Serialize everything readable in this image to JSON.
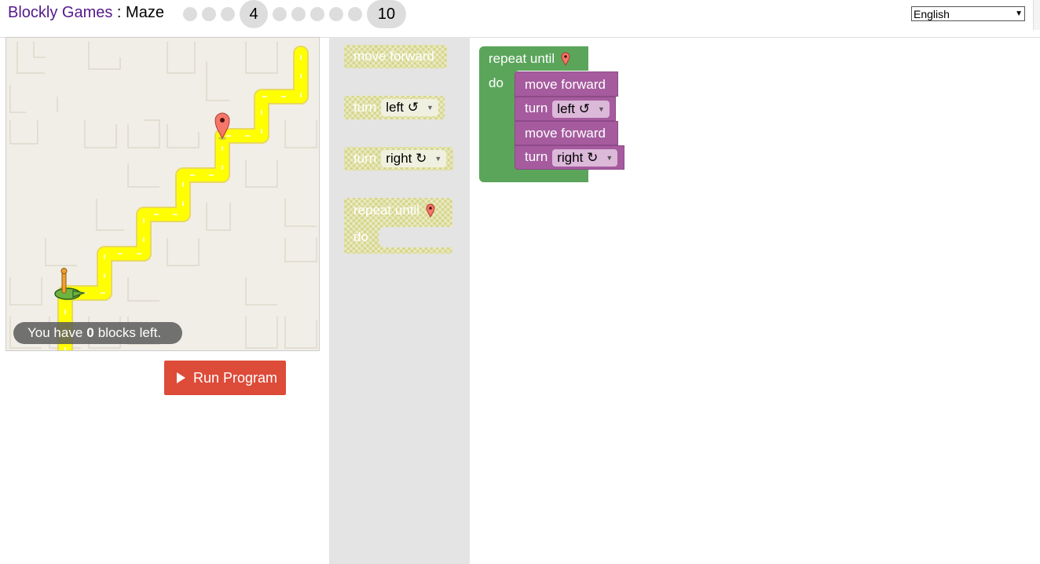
{
  "header": {
    "brand": "Blockly Games",
    "separator": " : ",
    "game": "Maze",
    "levels": [
      {
        "n": "1",
        "current": false,
        "shown": false
      },
      {
        "n": "2",
        "current": false,
        "shown": false
      },
      {
        "n": "3",
        "current": false,
        "shown": false
      },
      {
        "n": "4",
        "current": true,
        "shown": true
      },
      {
        "n": "5",
        "current": false,
        "shown": false
      },
      {
        "n": "6",
        "current": false,
        "shown": false
      },
      {
        "n": "7",
        "current": false,
        "shown": false
      },
      {
        "n": "8",
        "current": false,
        "shown": false
      },
      {
        "n": "9",
        "current": false,
        "shown": false
      },
      {
        "n": "10",
        "current": false,
        "shown": true
      }
    ],
    "current_level": "4",
    "last_level": "10",
    "language": "English"
  },
  "maze": {
    "capacity_prefix": "You have",
    "capacity_count": "0",
    "capacity_suffix": "blocks left."
  },
  "run_button": "Run Program",
  "toolbox": {
    "move_forward": "move forward",
    "turn_left_label": "turn",
    "turn_left_field": "left ↺",
    "turn_right_label": "turn",
    "turn_right_field": "right ↻",
    "repeat_until": "repeat until",
    "do": "do"
  },
  "workspace": {
    "repeat_until": "repeat until",
    "do": "do",
    "move_forward_1": "move forward",
    "turn_1": "turn",
    "turn_1_field": "left ↺",
    "move_forward_2": "move forward",
    "turn_2": "turn",
    "turn_2_field": "right ↻"
  },
  "colors": {
    "loop_block": "#5ba55b",
    "movement_block": "#a55b9e",
    "path": "#ffff00",
    "marker": "#f6766a",
    "run_button": "#dd4b39"
  }
}
